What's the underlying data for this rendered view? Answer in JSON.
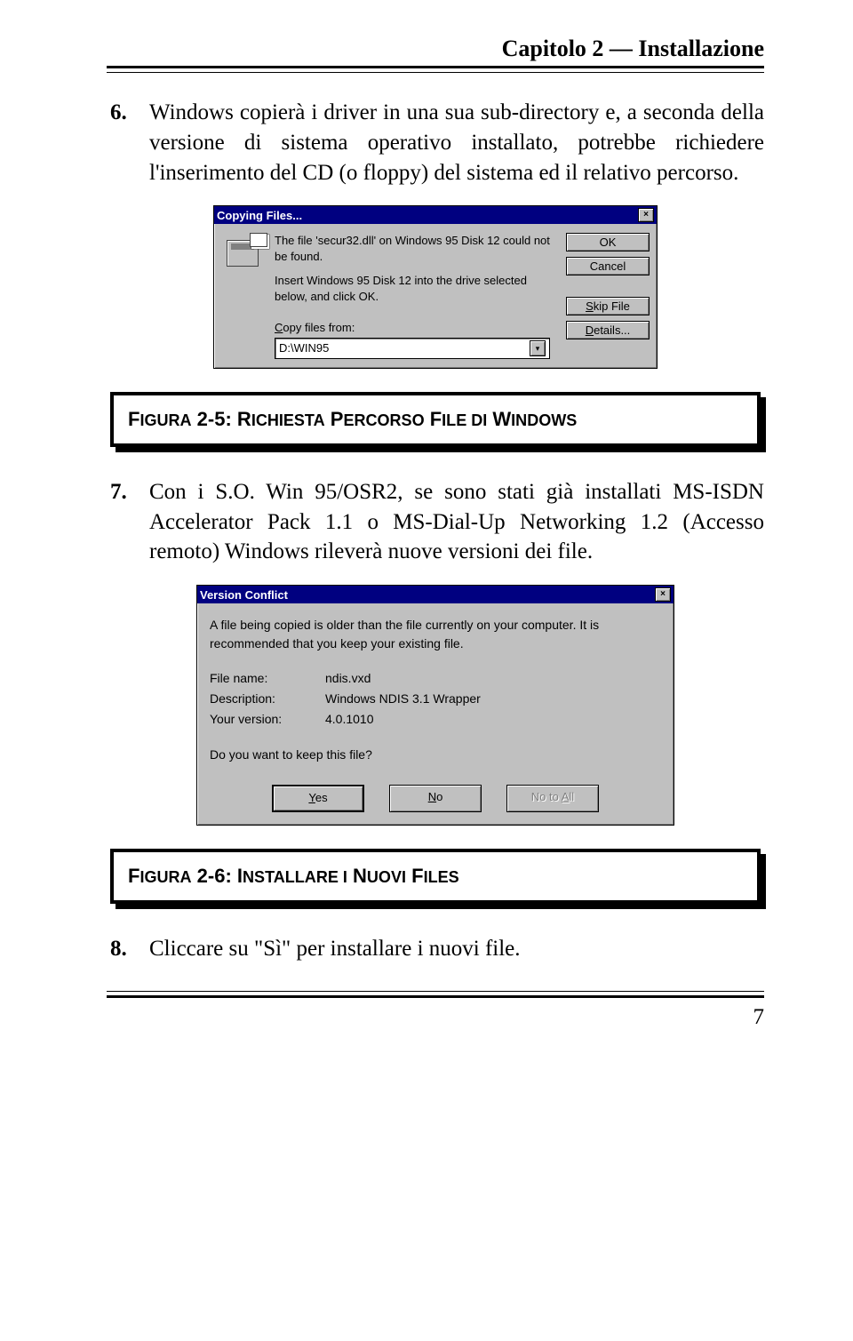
{
  "header": {
    "title": "Capitolo 2 — Installazione"
  },
  "items": {
    "six": {
      "num": "6.",
      "text": "Windows copierà i driver in una sua sub-directory e, a seconda della versione di sistema operativo installato, potrebbe richiedere l'inserimento del CD (o floppy) del sistema ed il relativo percorso."
    },
    "seven": {
      "num": "7.",
      "text": "Con i S.O. Win 95/OSR2, se sono stati già installati MS-ISDN Accelerator Pack 1.1 o MS-Dial-Up Networking 1.2 (Accesso remoto) Windows rileverà nuove versioni dei file."
    },
    "eight": {
      "num": "8.",
      "text": "Cliccare su \"Sì\" per installare i nuovi file."
    }
  },
  "dlg1": {
    "title": "Copying Files...",
    "line1": "The file 'secur32.dll' on Windows 95 Disk 12 could not be found.",
    "line2": "Insert Windows 95 Disk 12 into the drive selected below, and click OK.",
    "copy_label": "Copy files from:",
    "copy_value": "D:\\WIN95",
    "buttons": {
      "ok": "OK",
      "cancel": "Cancel",
      "skip": "Skip File",
      "details": "Details..."
    }
  },
  "dlg2": {
    "title": "Version Conflict",
    "intro": "A file being copied is older than the file currently on your computer. It is recommended that you keep your existing file.",
    "rows": {
      "filename_label": "File name:",
      "filename_value": "ndis.vxd",
      "description_label": "Description:",
      "description_value": "Windows NDIS 3.1 Wrapper",
      "version_label": "Your version:",
      "version_value": "4.0.1010"
    },
    "question": "Do you want to keep this file?",
    "buttons": {
      "yes": "Yes",
      "no": "No",
      "notoall": "No to All"
    }
  },
  "figures": {
    "fig25_pre1": "F",
    "fig25_sc1": "IGURA",
    "fig25_mid1": " 2-5: R",
    "fig25_sc2": "ICHIESTA",
    "fig25_mid2": " P",
    "fig25_sc3": "ERCORSO",
    "fig25_mid3": " F",
    "fig25_sc4": "ILE DI",
    "fig25_mid4": " W",
    "fig25_sc5": "INDOWS",
    "fig26_pre1": "F",
    "fig26_sc1": "IGURA",
    "fig26_mid1": " 2-6: I",
    "fig26_sc2": "NSTALLARE I",
    "fig26_mid2": " N",
    "fig26_sc3": "UOVI",
    "fig26_mid3": " F",
    "fig26_sc4": "ILES"
  },
  "page_number": "7"
}
